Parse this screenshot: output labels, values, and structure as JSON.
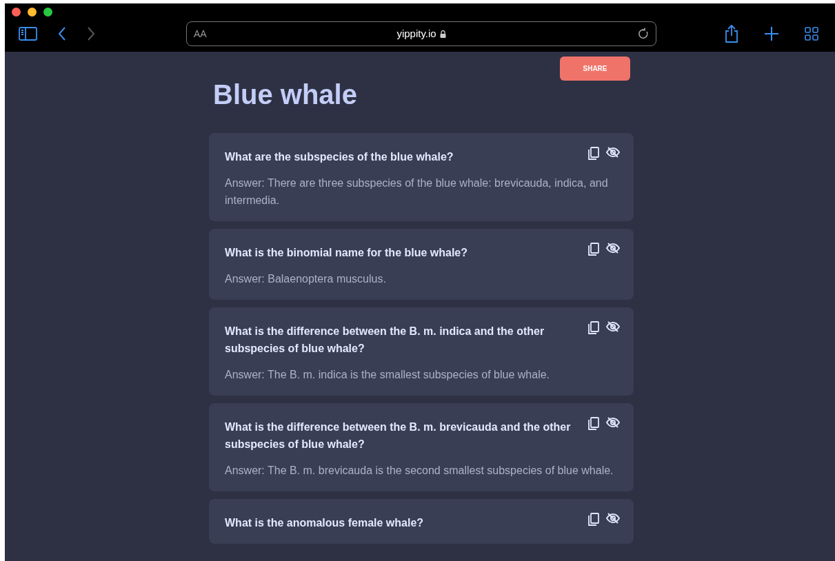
{
  "browser": {
    "text_size_button": "AA",
    "address": "yippity.io"
  },
  "share_button": "SHARE",
  "title": "Blue whale",
  "cards": [
    {
      "question": "What are the subspecies of the blue whale?",
      "answer": "Answer: There are three subspecies of the blue whale: brevicauda, indica, and intermedia."
    },
    {
      "question": "What is the binomial name for the blue whale?",
      "answer": "Answer: Balaenoptera musculus."
    },
    {
      "question": "What is the difference between the B. m. indica and the other subspecies of blue whale?",
      "answer": "Answer: The B. m. indica is the smallest subspecies of blue whale."
    },
    {
      "question": "What is the difference between the B. m. brevicauda and the other subspecies of blue whale?",
      "answer": "Answer: The B. m. brevicauda is the second smallest subspecies of blue whale."
    },
    {
      "question": "What is the anomalous female whale?"
    }
  ]
}
